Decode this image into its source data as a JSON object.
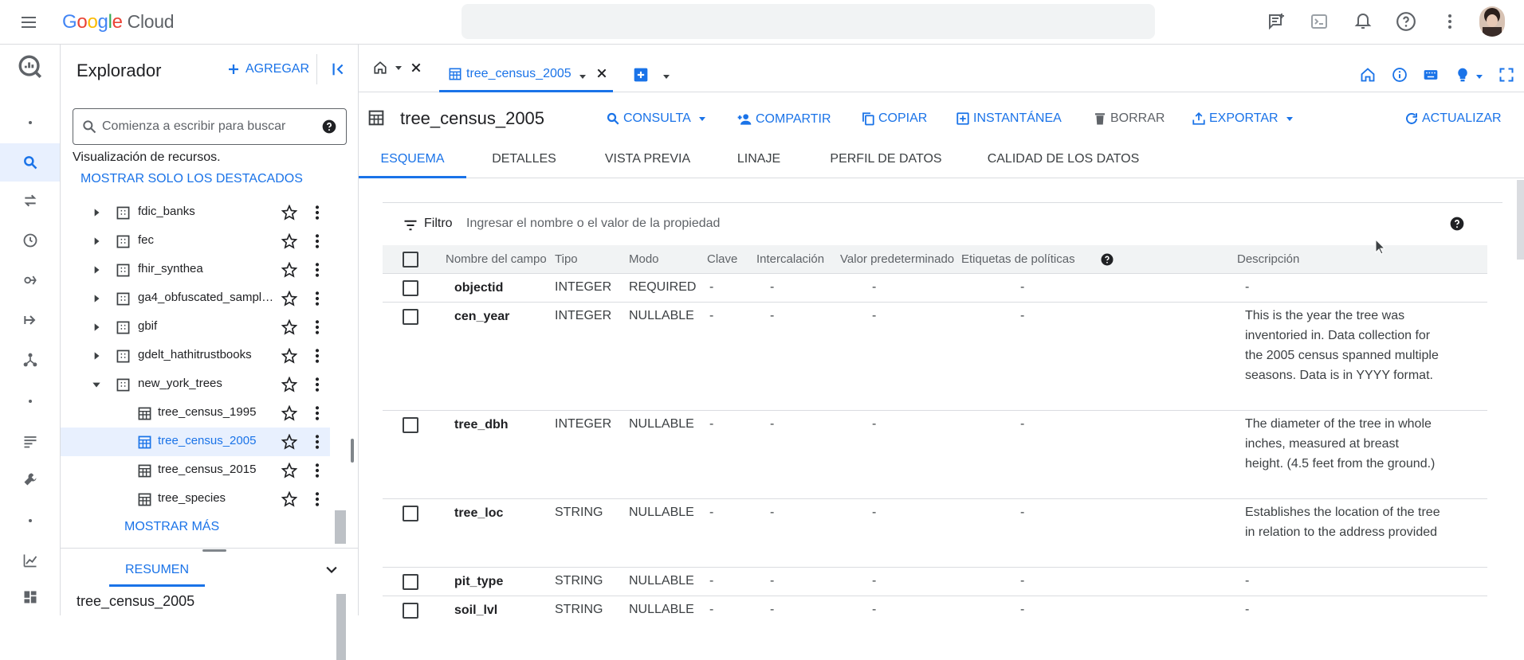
{
  "topbar": {
    "logo_google": "Google",
    "logo_cloud": "Cloud",
    "brand_colors": [
      "#4285f4",
      "#ea4335",
      "#fbbc04",
      "#4285f4",
      "#34a853",
      "#ea4335"
    ]
  },
  "rail": {
    "items": [
      "bigquery-logo-icon",
      "dot",
      "search-icon",
      "transfer-icon",
      "history-icon",
      "analytics-hub-icon",
      "dataflow-icon",
      "graph-icon",
      "dot",
      "list-icon",
      "wrench-icon",
      "dot",
      "chart-icon",
      "dashboard-icon"
    ]
  },
  "explorer": {
    "title": "Explorador",
    "add_label": "AGREGAR",
    "search_placeholder": "Comienza a escribir para buscar",
    "resources_label": "Visualización de recursos.",
    "show_starred": "MOSTRAR SOLO LOS DESTACADOS",
    "datasets": [
      {
        "label": "fdic_banks"
      },
      {
        "label": "fec"
      },
      {
        "label": "fhir_synthea"
      },
      {
        "label": "ga4_obfuscated_sample..."
      },
      {
        "label": "gbif"
      },
      {
        "label": "gdelt_hathitrustbooks"
      },
      {
        "label": "new_york_trees"
      }
    ],
    "tables": [
      {
        "label": "tree_census_1995"
      },
      {
        "label": "tree_census_2005"
      },
      {
        "label": "tree_census_2015"
      },
      {
        "label": "tree_species"
      }
    ],
    "show_more": "MOSTRAR MÁS",
    "summary_tab": "RESUMEN",
    "summary_title": "tree_census_2005"
  },
  "tabs": {
    "active_label": "tree_census_2005"
  },
  "header": {
    "title": "tree_census_2005",
    "actions": {
      "query": "CONSULTA",
      "share": "COMPARTIR",
      "copy": "COPIAR",
      "snapshot": "INSTANTÁNEA",
      "delete": "BORRAR",
      "export": "EXPORTAR",
      "refresh": "ACTUALIZAR"
    }
  },
  "subtabs": [
    "ESQUEMA",
    "DETALLES",
    "VISTA PREVIA",
    "LINAJE",
    "PERFIL DE DATOS",
    "CALIDAD DE LOS DATOS"
  ],
  "filter": {
    "label": "Filtro",
    "placeholder": "Ingresar el nombre o el valor de la propiedad"
  },
  "schema": {
    "columns": [
      "Nombre del campo",
      "Tipo",
      "Modo",
      "Clave",
      "Intercalación",
      "Valor predeterminado",
      "Etiquetas de políticas",
      "Descripción"
    ],
    "rows": [
      {
        "name": "objectid",
        "type": "INTEGER",
        "mode": "REQUIRED",
        "key": "-",
        "collation": "-",
        "default": "-",
        "policy": "-",
        "desc": "-"
      },
      {
        "name": "cen_year",
        "type": "INTEGER",
        "mode": "NULLABLE",
        "key": "-",
        "collation": "-",
        "default": "-",
        "policy": "-",
        "desc": "This is the year the tree was inventoried in. Data collection for the 2005 census spanned multiple seasons. Data is in YYYY format."
      },
      {
        "name": "tree_dbh",
        "type": "INTEGER",
        "mode": "NULLABLE",
        "key": "-",
        "collation": "-",
        "default": "-",
        "policy": "-",
        "desc": "The diameter of the tree in whole inches, measured at breast height. (4.5 feet from the ground.)"
      },
      {
        "name": "tree_loc",
        "type": "STRING",
        "mode": "NULLABLE",
        "key": "-",
        "collation": "-",
        "default": "-",
        "policy": "-",
        "desc": "Establishes the location of the tree in relation to the address provided"
      },
      {
        "name": "pit_type",
        "type": "STRING",
        "mode": "NULLABLE",
        "key": "-",
        "collation": "-",
        "default": "-",
        "policy": "-",
        "desc": "-"
      },
      {
        "name": "soil_lvl",
        "type": "STRING",
        "mode": "NULLABLE",
        "key": "-",
        "collation": "-",
        "default": "-",
        "policy": "-",
        "desc": "-"
      }
    ]
  },
  "colors": {
    "accent": "#1a73e8",
    "selected_bg": "#e8f0fe",
    "text": "#202124"
  }
}
